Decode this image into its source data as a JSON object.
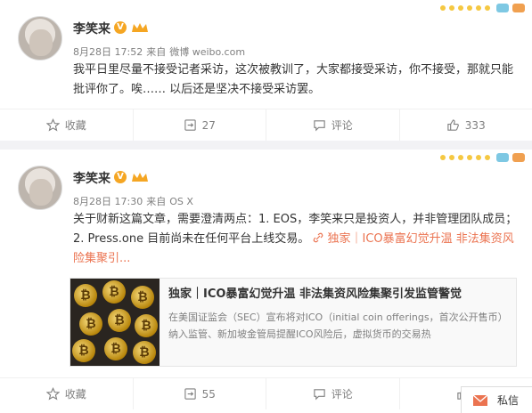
{
  "posts": [
    {
      "username": "李笑来",
      "badge": "V",
      "time": "8月28日 17:52",
      "source_prefix": "来自",
      "source": "微博 weibo.com",
      "text": "我平日里尽量不接受记者采访，这次被教训了，大家都接受采访，你不接受，那就只能批评你了。唉…… 以后还是坚决不接受采访罢。",
      "actions": {
        "favorite": "收藏",
        "repost": "27",
        "comment": "评论",
        "like": "333"
      }
    },
    {
      "username": "李笑来",
      "badge": "V",
      "time": "8月28日 17:30",
      "source_prefix": "来自",
      "source": "OS X",
      "text": "关于财新这篇文章，需要澄清两点：1. EOS，李笑来只是投资人，并非管理团队成员；2. Press.one 目前尚未在任何平台上线交易。",
      "link_text": "独家｜ICO暴富幻觉升温 非法集资风险集聚引...",
      "card": {
        "title": "独家｜ICO暴富幻觉升温 非法集资风险集聚引发监管警觉",
        "desc": "在美国证监会（SEC）宣布将对ICO（initial coin offerings，首次公开售币）纳入监管、新加坡金管局提醒ICO风险后，虚拟货币的交易热"
      },
      "actions": {
        "favorite": "收藏",
        "repost": "55",
        "comment": "评论",
        "like": ""
      }
    }
  ],
  "message_button": "私信",
  "colors": {
    "link": "#eb7350",
    "badge": "#f5a623",
    "text": "#333333",
    "meta": "#808080"
  }
}
